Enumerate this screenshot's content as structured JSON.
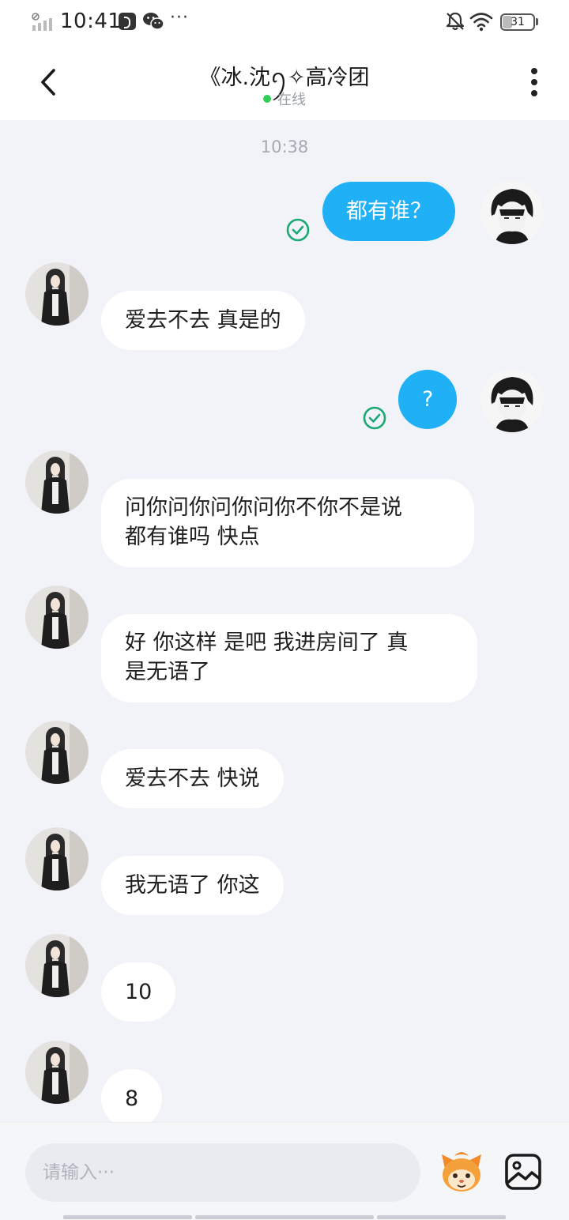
{
  "status_bar": {
    "time": "10:41",
    "more": "···",
    "battery_level": "31",
    "battery_fraction": 0.31,
    "icons": [
      "signal-icon",
      "music-app-icon",
      "wechat-icon",
      "mute-icon",
      "wifi-icon",
      "battery-icon"
    ]
  },
  "header": {
    "title": "《冰.沈ꪆ✧高冷团",
    "presence": "在线",
    "presence_color": "#2fcf55"
  },
  "chat": {
    "timestamp": "10:38",
    "messages": [
      {
        "side": "out",
        "text": "都有谁？"
      },
      {
        "side": "in",
        "text": "爱去不去 真是的"
      },
      {
        "side": "out",
        "text": "?"
      },
      {
        "side": "in",
        "text": "问你问你问你问你不你不是说\n都有谁吗 快点"
      },
      {
        "side": "in",
        "text": "好 你这样 是吧 我进房间了 真\n是无语了"
      },
      {
        "side": "in",
        "text": "爱去不去 快说"
      },
      {
        "side": "in",
        "text": "我无语了 你这"
      },
      {
        "side": "in",
        "text": "10"
      },
      {
        "side": "in",
        "text": "8"
      }
    ]
  },
  "input": {
    "placeholder": "请输入···",
    "value": ""
  },
  "colors": {
    "outgoing_bubble": "#1fb0f5",
    "incoming_bubble": "#ffffff",
    "chat_background": "#f1f3f9",
    "read_check": "#1aa873"
  }
}
